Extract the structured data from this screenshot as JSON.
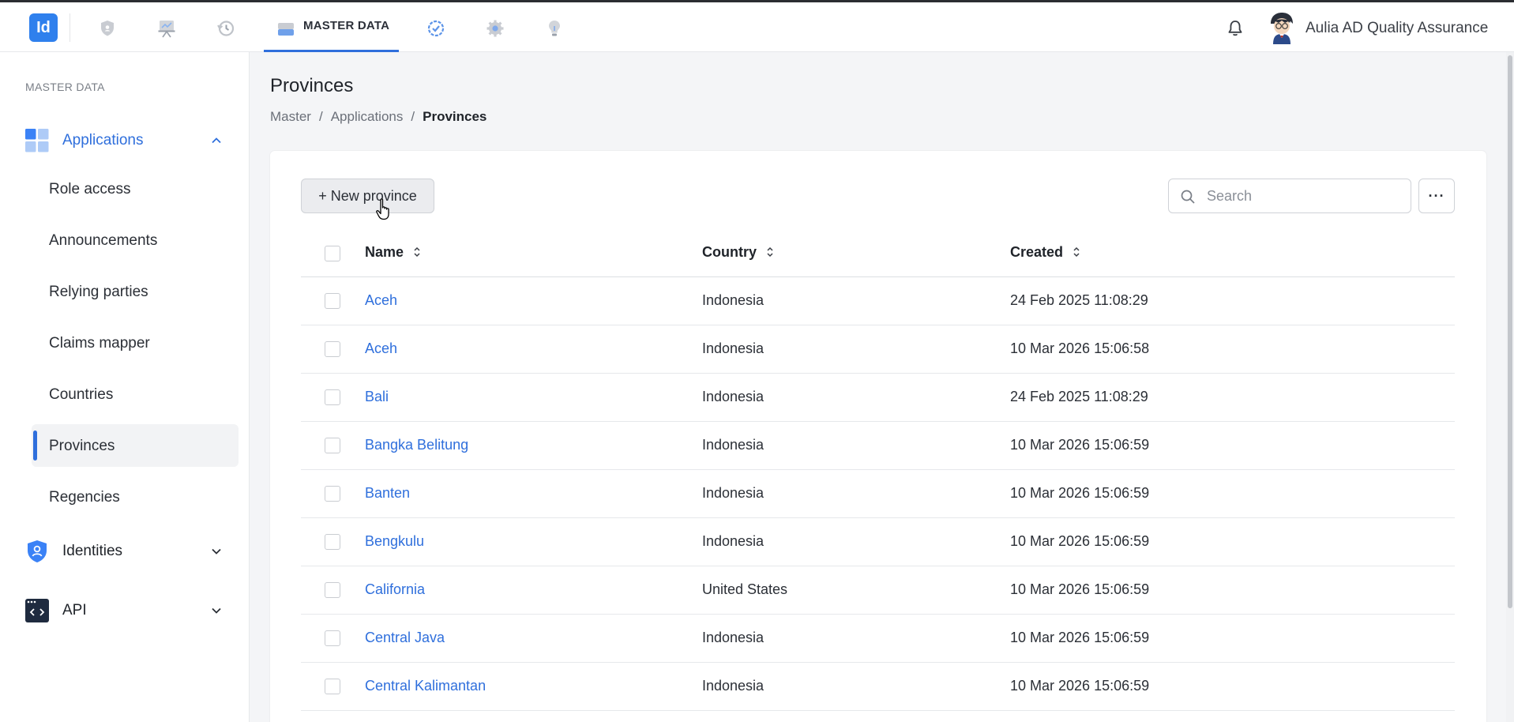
{
  "app": {
    "logo_text": "Id"
  },
  "topnav": {
    "active_tab": "MASTER DATA",
    "icons": [
      "shield-icon",
      "presentation-icon",
      "history-icon",
      "database-icon",
      "verified-badge-icon",
      "gear-icon",
      "lightbulb-icon"
    ],
    "user_name": "Aulia AD Quality Assurance"
  },
  "sidebar": {
    "section_title": "MASTER DATA",
    "groups": [
      {
        "label": "Applications",
        "expanded": true,
        "items": [
          {
            "label": "Role access"
          },
          {
            "label": "Announcements"
          },
          {
            "label": "Relying parties"
          },
          {
            "label": "Claims mapper"
          },
          {
            "label": "Countries"
          },
          {
            "label": "Provinces",
            "active": true
          },
          {
            "label": "Regencies"
          }
        ]
      },
      {
        "label": "Identities",
        "expanded": false
      },
      {
        "label": "API",
        "expanded": false
      }
    ]
  },
  "page": {
    "title": "Provinces",
    "breadcrumb": [
      "Master",
      "Applications",
      "Provinces"
    ]
  },
  "toolbar": {
    "new_button": "+ New province",
    "search_placeholder": "Search",
    "more_label": "···"
  },
  "table": {
    "columns": [
      "Name",
      "Country",
      "Created"
    ],
    "rows": [
      {
        "name": "Aceh",
        "country": "Indonesia",
        "created": "24 Feb 2025 11:08:29"
      },
      {
        "name": "Aceh",
        "country": "Indonesia",
        "created": "10 Mar 2026 15:06:58"
      },
      {
        "name": "Bali",
        "country": "Indonesia",
        "created": "24 Feb 2025 11:08:29"
      },
      {
        "name": "Bangka Belitung",
        "country": "Indonesia",
        "created": "10 Mar 2026 15:06:59"
      },
      {
        "name": "Banten",
        "country": "Indonesia",
        "created": "10 Mar 2026 15:06:59"
      },
      {
        "name": "Bengkulu",
        "country": "Indonesia",
        "created": "10 Mar 2026 15:06:59"
      },
      {
        "name": "California",
        "country": "United States",
        "created": "10 Mar 2026 15:06:59"
      },
      {
        "name": "Central Java",
        "country": "Indonesia",
        "created": "10 Mar 2026 15:06:59"
      },
      {
        "name": "Central Kalimantan",
        "country": "Indonesia",
        "created": "10 Mar 2026 15:06:59"
      }
    ]
  },
  "colors": {
    "accent": "#2f6fdc",
    "brand": "#2f80ed",
    "link": "#2f6fdc"
  }
}
